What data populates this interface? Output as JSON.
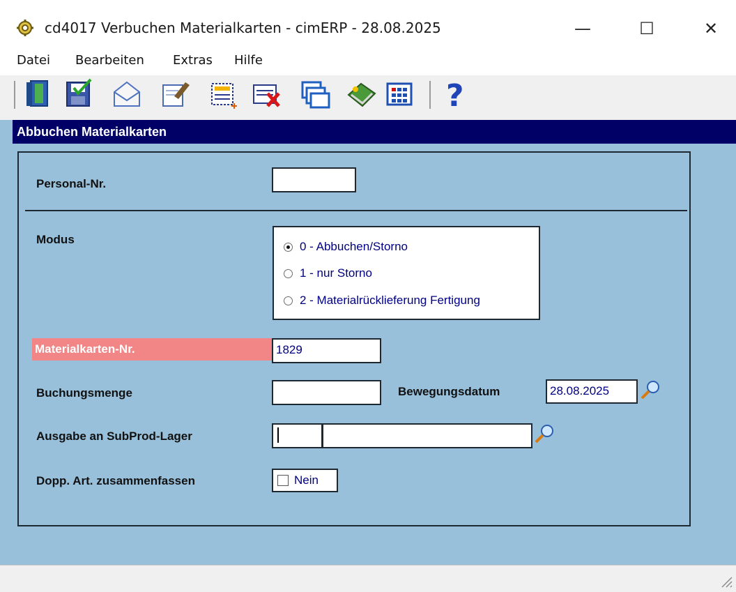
{
  "window": {
    "title": "cd4017 Verbuchen Materialkarten - cimERP - 28.08.2025",
    "minimize": "—",
    "maximize": "☐",
    "close": "✕"
  },
  "menu": {
    "items": [
      {
        "label": "Datei"
      },
      {
        "label": "Bearbeiten"
      },
      {
        "label": "Extras"
      },
      {
        "label": "Hilfe"
      }
    ]
  },
  "toolbar": {
    "icons": [
      "exit-door-icon",
      "save-icon",
      "mail-icon",
      "edit-record-icon",
      "new-record-icon",
      "delete-record-icon",
      "windows-icon",
      "book-icon",
      "grid-icon",
      "help-icon"
    ]
  },
  "panel": {
    "header": "Abbuchen Materialkarten"
  },
  "form": {
    "personal_label": "Personal-Nr.",
    "personal_value": "",
    "modus_label": "Modus",
    "modus_options": [
      {
        "label": "0 - Abbuchen/Storno",
        "selected": true
      },
      {
        "label": "1 - nur Storno",
        "selected": false
      },
      {
        "label": "2 - Materialrücklieferung Fertigung",
        "selected": false
      }
    ],
    "materialkarte_label": "Materialkarten-Nr.",
    "materialkarte_value": "1829",
    "buchungsmenge_label": "Buchungsmenge",
    "buchungsmenge_value": "",
    "bewegungsdatum_label": "Bewegungsdatum",
    "bewegungsdatum_value": "28.08.2025",
    "subprod_label": "Ausgabe an SubProd-Lager",
    "subprod_code": "",
    "subprod_name": "",
    "dopp_label": "Dopp. Art. zusammenfassen",
    "dopp_checked": false,
    "dopp_value": "Nein"
  },
  "colors": {
    "header_bg": "#000066",
    "content_bg": "#98c0da",
    "highlight": "#f28585",
    "value_text": "#000080"
  }
}
